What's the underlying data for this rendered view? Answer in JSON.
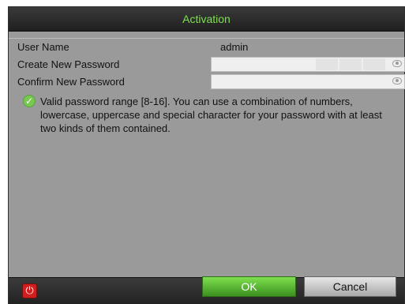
{
  "dialog": {
    "title": "Activation",
    "username_label": "User Name",
    "username_value": "admin",
    "create_password_label": "Create New Password",
    "create_password_value": "",
    "confirm_password_label": "Confirm New Password",
    "confirm_password_value": "",
    "hint_icon": "check-icon",
    "hint_text": "Valid password range [8-16]. You can use a combination of numbers, lowercase, uppercase and special character for your password with at least two kinds of them contained."
  },
  "footer": {
    "power_icon": "power-icon",
    "ok_label": "OK",
    "cancel_label": "Cancel"
  },
  "colors": {
    "title_text": "#7ee04e",
    "panel_bg": "#9a9a9a",
    "ok_button": "#5db33a",
    "power_button": "#d11e1e"
  }
}
